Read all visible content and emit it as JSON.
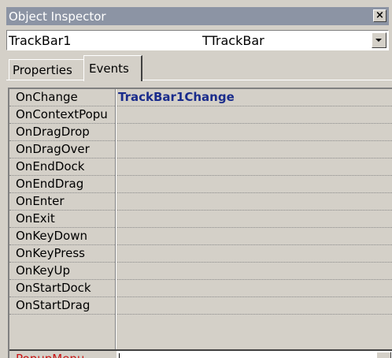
{
  "window": {
    "title": "Object Inspector",
    "close_glyph": "×"
  },
  "component_selector": {
    "name": "TrackBar1",
    "type": "TTrackBar"
  },
  "tabs": [
    {
      "label": "Properties",
      "selected": false
    },
    {
      "label": "Events",
      "selected": true
    }
  ],
  "events": [
    {
      "name": "OnChange",
      "value": "TrackBar1Change"
    },
    {
      "name": "OnContextPopu",
      "value": ""
    },
    {
      "name": "OnDragDrop",
      "value": ""
    },
    {
      "name": "OnDragOver",
      "value": ""
    },
    {
      "name": "OnEndDock",
      "value": ""
    },
    {
      "name": "OnEndDrag",
      "value": ""
    },
    {
      "name": "OnEnter",
      "value": ""
    },
    {
      "name": "OnExit",
      "value": ""
    },
    {
      "name": "OnKeyDown",
      "value": ""
    },
    {
      "name": "OnKeyPress",
      "value": ""
    },
    {
      "name": "OnKeyUp",
      "value": ""
    },
    {
      "name": "OnStartDock",
      "value": ""
    },
    {
      "name": "OnStartDrag",
      "value": ""
    }
  ],
  "active_row": {
    "name": "PopupMenu",
    "value": ""
  },
  "colors": {
    "titlebar": "#8c94a4",
    "window_bg": "#d4d0c8",
    "event_value": "#1a2c8c",
    "active_name": "#c81414"
  },
  "icons": {
    "close": "close-icon",
    "dropdown": "chevron-down-icon"
  }
}
